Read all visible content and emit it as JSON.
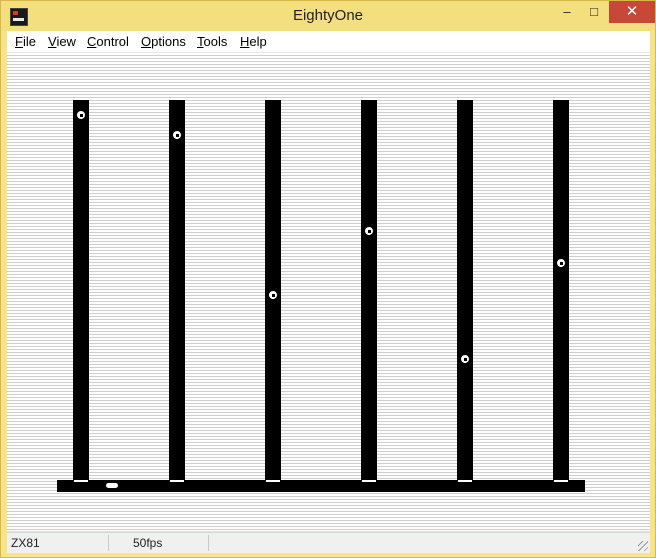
{
  "window": {
    "title": "EightyOne",
    "controls": {
      "minimize": "–",
      "maximize": "□",
      "close": "✕"
    }
  },
  "menu": {
    "file": {
      "ul": "F",
      "rest": "ile"
    },
    "view": {
      "ul": "V",
      "rest": "iew"
    },
    "control": {
      "ul": "C",
      "rest": "ontrol"
    },
    "options": {
      "ul": "O",
      "rest": "ptions"
    },
    "tools": {
      "ul": "T",
      "rest": "ools"
    },
    "help": {
      "ul": "H",
      "rest": "elp"
    }
  },
  "status": {
    "machine": "ZX81",
    "fps": "50fps"
  },
  "colors": {
    "titlebar": "#f4df7e",
    "close_button": "#c84838",
    "screen_ink": "#000000",
    "screen_paper": "#ffffff"
  }
}
